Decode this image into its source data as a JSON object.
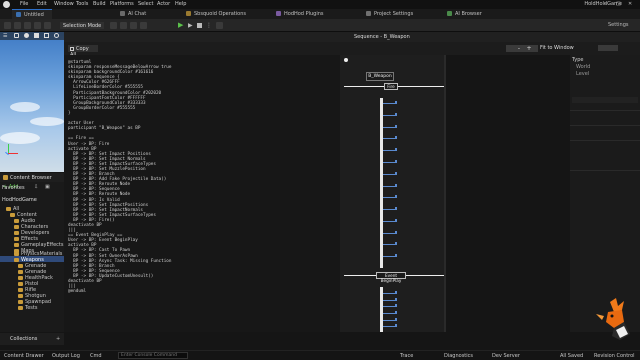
{
  "menu": {
    "items": [
      "File",
      "Edit",
      "Window",
      "Tools",
      "Build",
      "Platforms",
      "Select",
      "Actor",
      "Help"
    ],
    "project_name": "HoldHoldGame"
  },
  "tabs": [
    {
      "label": "Untitled",
      "color": "#3a6fb0"
    },
    {
      "label": "AI Chat",
      "color": "#6a6a6a"
    },
    {
      "label": "Sbsquoid Operations",
      "color": "#9a7a30"
    },
    {
      "label": "HodHod Plugins",
      "color": "#7a5aa0"
    },
    {
      "label": "Project Settings",
      "color": "#707070"
    },
    {
      "label": "AI Browser",
      "color": "#4a8a4a"
    }
  ],
  "toolbar": {
    "selection_mode": "Selection Mode",
    "settings": "Settings"
  },
  "content_browser": {
    "tab_label": "Content Browser",
    "add_label": "+ Add",
    "favorites": "Favorites",
    "project": "HodHodGame",
    "all_label": "All",
    "tree": [
      "Content",
      "Audio",
      "Characters",
      "Developers",
      "Effects",
      "GameplayEffects",
      "Maps",
      "PhysicsMaterials",
      "Weapons",
      "Grenade",
      "Grenade",
      "HealthPack",
      "Pistol",
      "Rifle",
      "Shotgun",
      "Spawnpad",
      "Tests"
    ],
    "collections": "Collections"
  },
  "sequence": {
    "title": "Sequence - B_Weapon",
    "copy_label": "Copy All",
    "minus": "-",
    "plus": "+",
    "code": "@startuml\nskinparam responseMessageBelowArrow true\nskinparam backgroundColor #161616\nskinparam sequence {\n  ArrowColor #626FFF\n  LifeLineBorderColor #555555\n  ParticipantBackgroundColor #202020\n  ParticipantFontColor #FFFFFF\n  GroupBackgroundColor #333333\n  GroupBorderColor #555555\n}\n\nactor User\nparticipant \"B_Weapon\" as BP\n\n== Fire ==\nUser -> BP: Fire\nactivate BP\n  BP -> BP: Set Impact Positions\n  BP -> BP: Set Impact Normals\n  BP -> BP: Set ImpactSurfaceTypes\n  BP -> BP: Set MuzzlePosition\n  BP -> BP: Branch\n  BP -> BP: Add Fake Projectile Data()\n  BP -> BP: Reroute Node\n  BP -> BP: Sequence\n  BP -> BP: Reroute Node\n  BP -> BP: Is Valid\n  BP -> BP: Set ImpactPositions\n  BP -> BP: Set ImpactNormals\n  BP -> BP: Set ImpactSurfaceTypes\n  BP -> BP: Fire()\ndeactivate BP\n|||\n== Event BeginPlay ==\nUser -> BP: Event BeginPlay\nactivate BP\n  BP -> BP: Cast To Pawn\n  BP -> BP: Set OwnerAsPawn\n  BP -> BP: Async Task: Missing Function\n  BP -> BP: Branch\n  BP -> BP: Sequence\n  BP -> BP: UpdateCustomUnesult()\ndeactivate BP\n|||\n@enduml",
    "participant": "B_Weapon",
    "groups": [
      "Fire",
      "Event BeginPlay"
    ]
  },
  "details": {
    "fit_label": "Fit to Window",
    "type_label": "Type",
    "world_label": "World",
    "level_label": "Level"
  },
  "status": {
    "content_drawer": "Content Drawer",
    "output_log": "Output Log",
    "cmd": "Cmd",
    "cmd_placeholder": "Enter Console Command",
    "trace": "Trace",
    "diagnostics": "Diagnostics",
    "derived_data": "Dev Server",
    "all_saved": "All Saved",
    "revision_control": "Revision Control"
  }
}
